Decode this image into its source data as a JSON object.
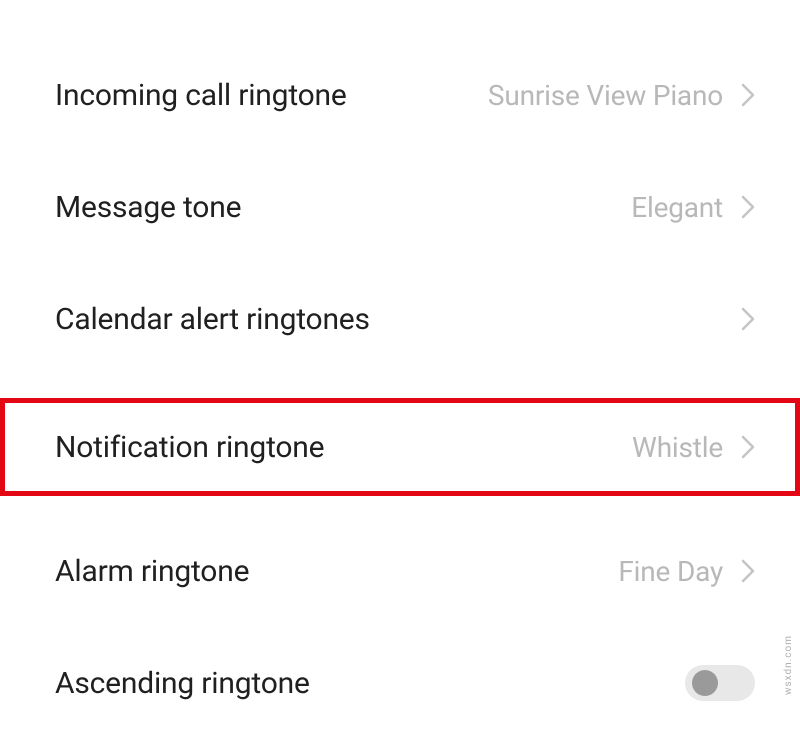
{
  "settings": {
    "incoming_call": {
      "label": "Incoming call ringtone",
      "value": "Sunrise View Piano"
    },
    "message_tone": {
      "label": "Message tone",
      "value": "Elegant"
    },
    "calendar_alert": {
      "label": "Calendar alert ringtones",
      "value": ""
    },
    "notification": {
      "label": "Notification ringtone",
      "value": "Whistle"
    },
    "alarm": {
      "label": "Alarm ringtone",
      "value": "Fine Day"
    },
    "ascending": {
      "label": "Ascending ringtone"
    }
  },
  "watermark": "wsxdn.com"
}
